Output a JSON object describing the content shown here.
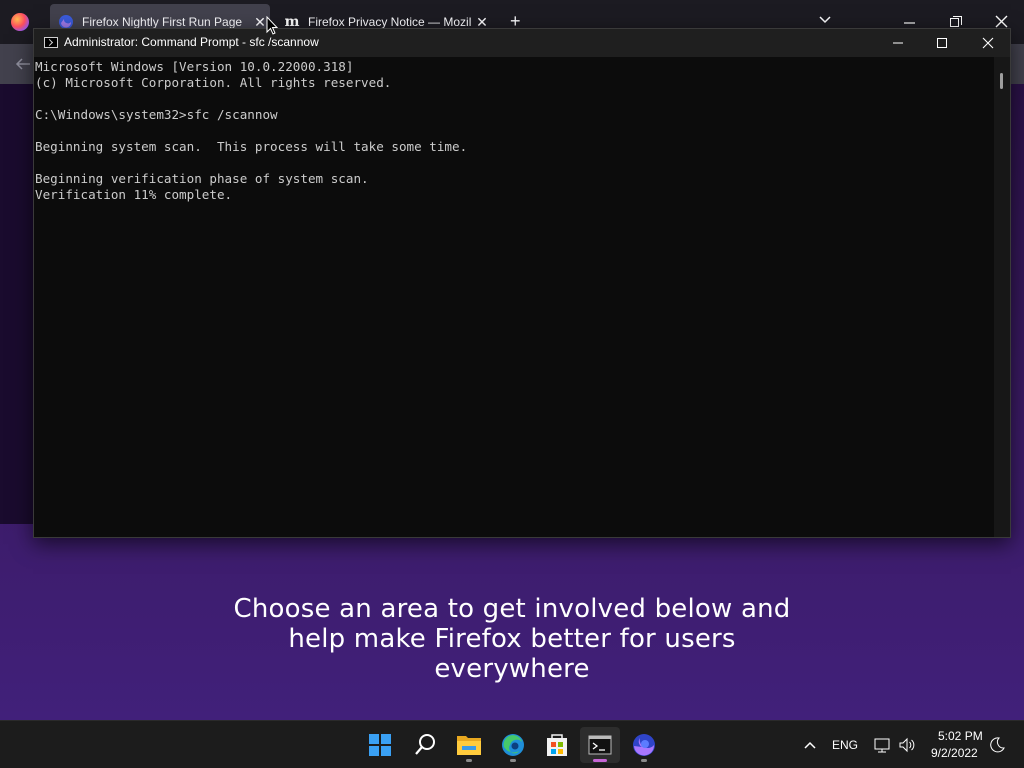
{
  "browser": {
    "tabs": [
      {
        "label": "Firefox Nightly First Run Page",
        "close": "✕"
      },
      {
        "label": "Firefox Privacy Notice — Mozilla",
        "close": "✕"
      }
    ],
    "new_tab": "+",
    "promo_text": "Choose an area to get involved below and help make Firefox better for users everywhere"
  },
  "cmd": {
    "title": "Administrator: Command Prompt - sfc  /scannow",
    "lines": [
      "Microsoft Windows [Version 10.0.22000.318]",
      "(c) Microsoft Corporation. All rights reserved.",
      "",
      "C:\\Windows\\system32>sfc /scannow",
      "",
      "Beginning system scan.  This process will take some time.",
      "",
      "Beginning verification phase of system scan.",
      "Verification 11% complete."
    ]
  },
  "taskbar": {
    "apps": [
      "start-icon",
      "search-icon",
      "file-explorer-icon",
      "edge-icon",
      "store-icon",
      "terminal-icon",
      "firefox-nightly-icon"
    ],
    "tray": {
      "language": "ENG",
      "time": "5:02 PM",
      "date": "9/2/2022"
    }
  },
  "colors": {
    "accent": "#c766d6",
    "console_bg": "#0c0c0c",
    "console_text": "#cccccc",
    "page_purple": "#3a1a63"
  }
}
